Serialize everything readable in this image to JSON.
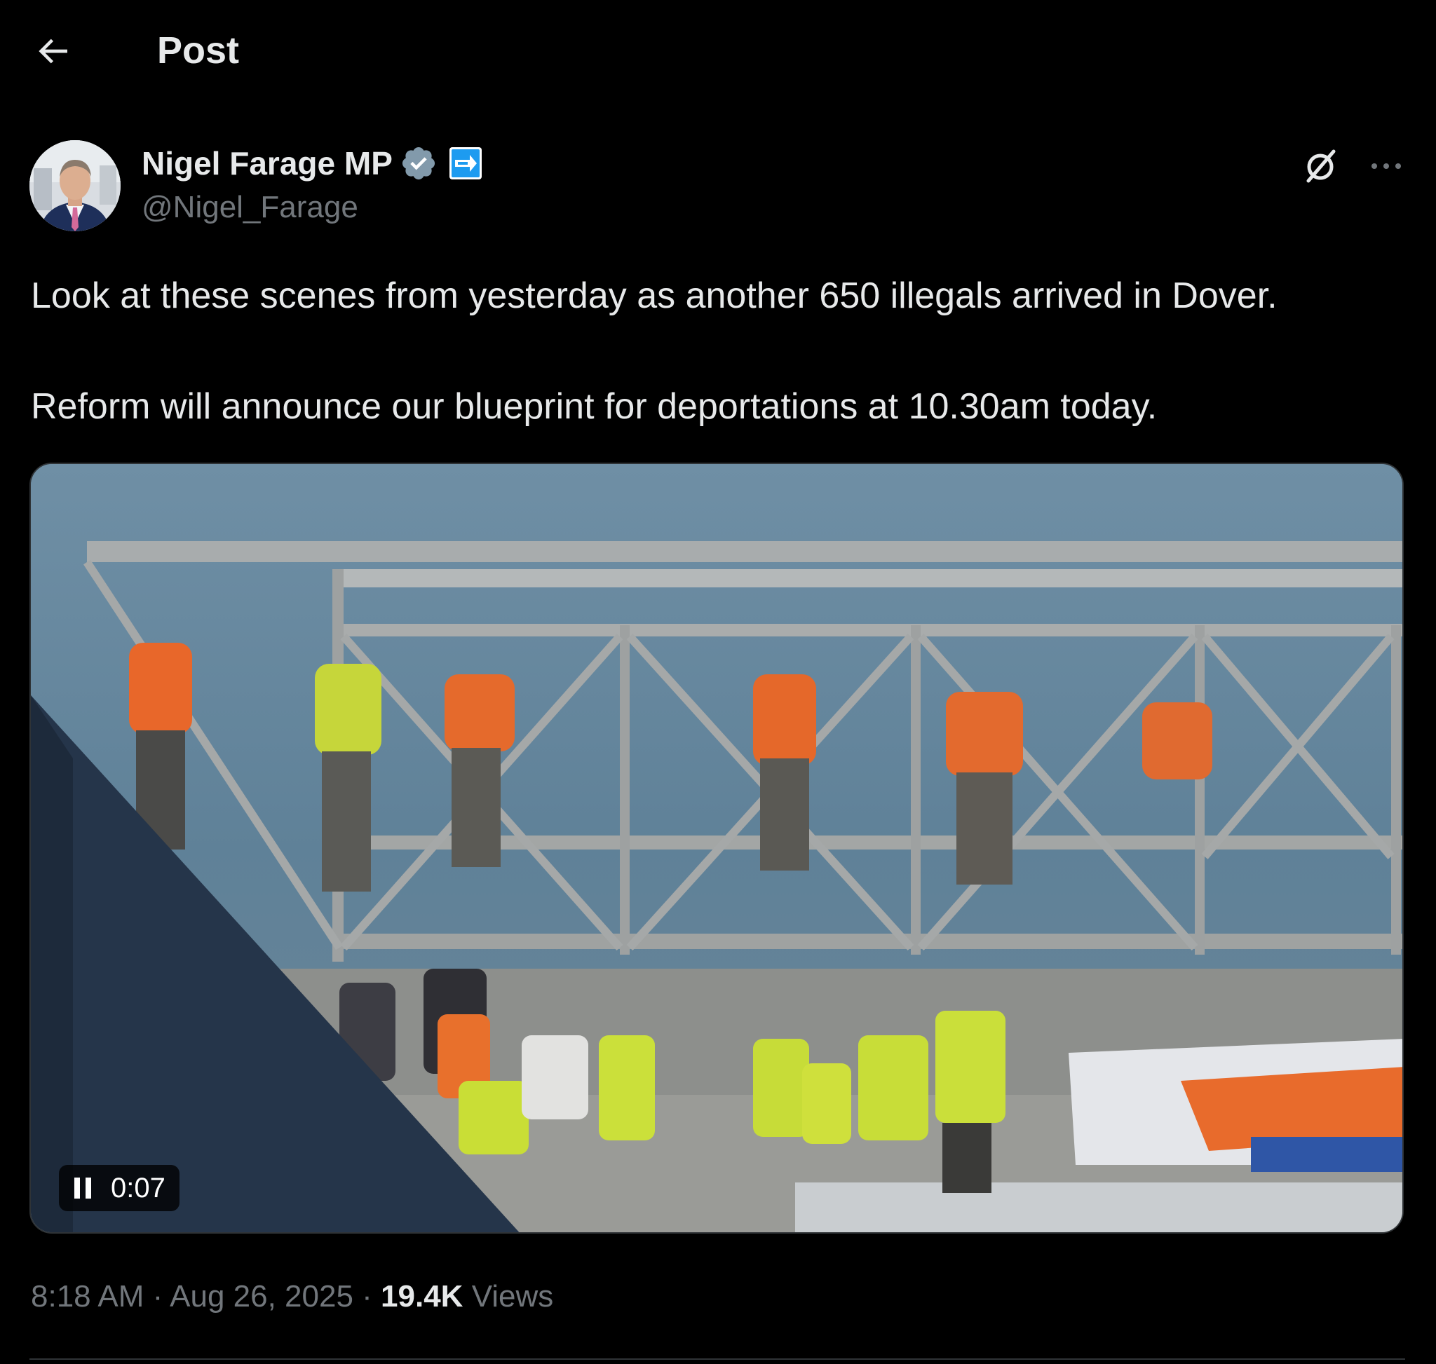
{
  "header": {
    "title": "Post",
    "back_icon": "arrow-left-icon"
  },
  "author": {
    "name": "Nigel Farage MP",
    "handle": "@Nigel_Farage",
    "verified_icon": "verified-badge-icon",
    "affiliate_icon": "affiliate-badge-icon"
  },
  "actions": {
    "grok_icon": "grok-icon",
    "more_icon": "more-horizontal-icon"
  },
  "post": {
    "paragraphs": [
      "Look at these scenes from yesterday as another 650 illegals arrived in Dover.",
      "Reform will announce our blueprint for deportations at 10.30am today."
    ]
  },
  "media": {
    "type": "video",
    "elapsed": "0:07",
    "pause_icon": "pause-icon"
  },
  "meta": {
    "time": "8:18 AM",
    "separator": "·",
    "date": "Aug 26, 2025",
    "views_count": "19.4K",
    "views_label": "Views"
  },
  "colors": {
    "background": "#000000",
    "text_primary": "#e7e9ea",
    "text_secondary": "#71767b",
    "verified_badge": "#829aab",
    "affiliate_badge": "#1d9bf0",
    "divider": "#2f3336"
  }
}
